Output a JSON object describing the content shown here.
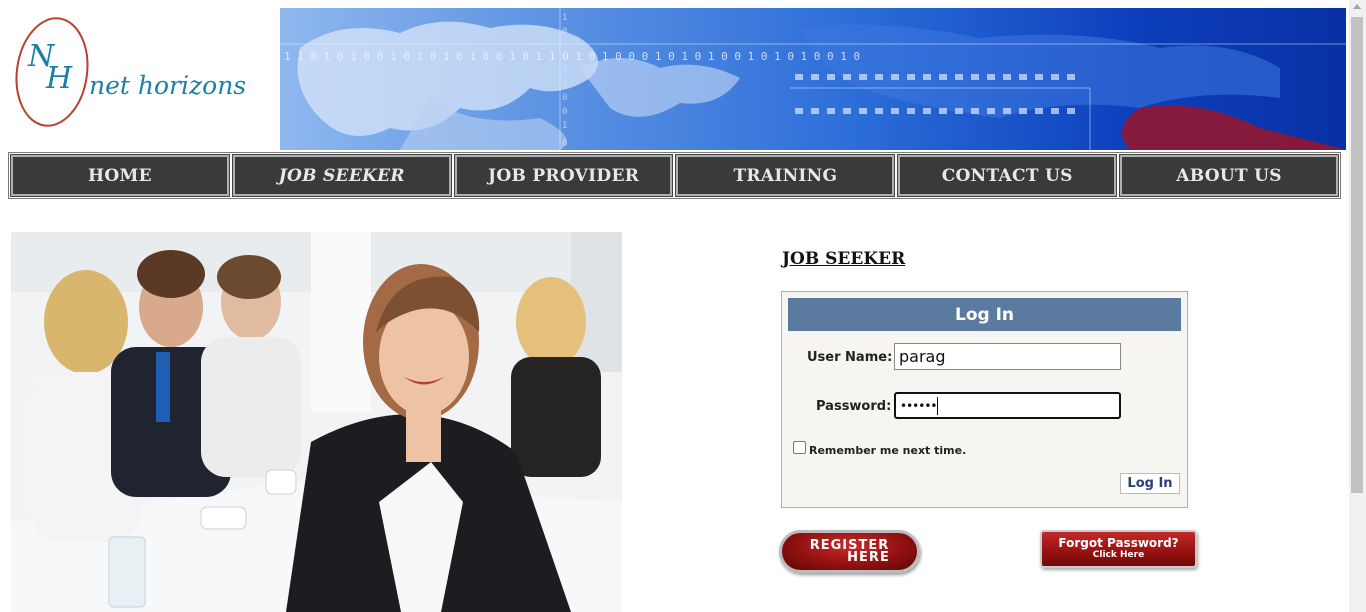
{
  "logo": {
    "initials": "NH",
    "brand_text": "net horizons"
  },
  "banner": {
    "binary_text": "1 1 0 1 0 1 0 0 1 0 1 0 1 0 1 0 0 1 0 1 1 0 1 0 1 0 0 0 1 0 1 0 1 0 0 1 0 1 0 1 0 0 1 0"
  },
  "nav": {
    "items": [
      {
        "label": "HOME"
      },
      {
        "label": "JOB SEEKER"
      },
      {
        "label": "JOB PROVIDER"
      },
      {
        "label": "TRAINING"
      },
      {
        "label": "CONTACT US"
      },
      {
        "label": "ABOUT US"
      }
    ],
    "active_index": 1
  },
  "section_title": "JOB SEEKER",
  "login": {
    "heading": "Log In",
    "username_label": "User Name:",
    "username_value": "parag",
    "password_label": "Password:",
    "password_value": "••••••",
    "remember_label": "Remember me next time.",
    "submit_label": "Log In"
  },
  "register": {
    "line1": "REGISTER",
    "line2": "HERE"
  },
  "forgot": {
    "line1": "Forgot Password?",
    "line2": "Click Here"
  },
  "colors": {
    "nav_bg": "#3a3a3a",
    "login_header": "#5a7aa0",
    "button_red": "#8d0f0f",
    "banner_blue": "#2a6cd8"
  }
}
